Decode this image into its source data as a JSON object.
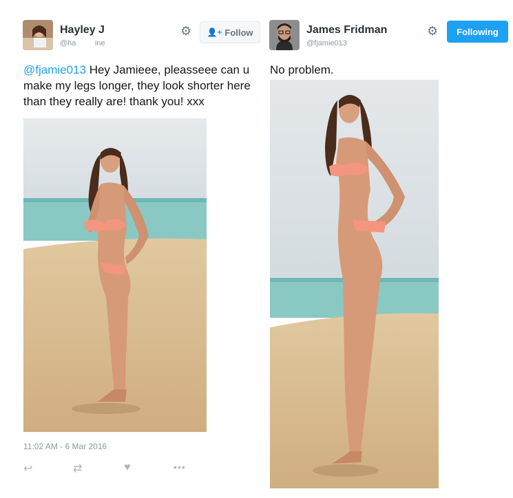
{
  "left_tweet": {
    "user_name": "Hayley J",
    "user_handle": "@ha         ine",
    "follow_label": "Follow",
    "mention": "@fjamie013",
    "text": " Hey Jamieee, pleasseee can u make my legs longer, they look shorter here than they really are! thank you! xxx",
    "timestamp": "11:02 AM - 6 Mar 2016"
  },
  "right_tweet": {
    "user_name": "James Fridman",
    "user_handle": "@fjamie013",
    "following_label": "Following",
    "text": "No problem."
  },
  "icons": {
    "gear": "gear-icon",
    "follow": "person-plus-icon",
    "reply": "reply-icon",
    "retweet": "retweet-icon",
    "like": "heart-icon",
    "more": "more-icon"
  },
  "colors": {
    "accent": "#1da1f2",
    "text_muted": "#8899a6",
    "sky": "#dce2e6",
    "sea": "#7fc4c2",
    "sand": "#d9bd92",
    "bikini": "#f4957f"
  }
}
